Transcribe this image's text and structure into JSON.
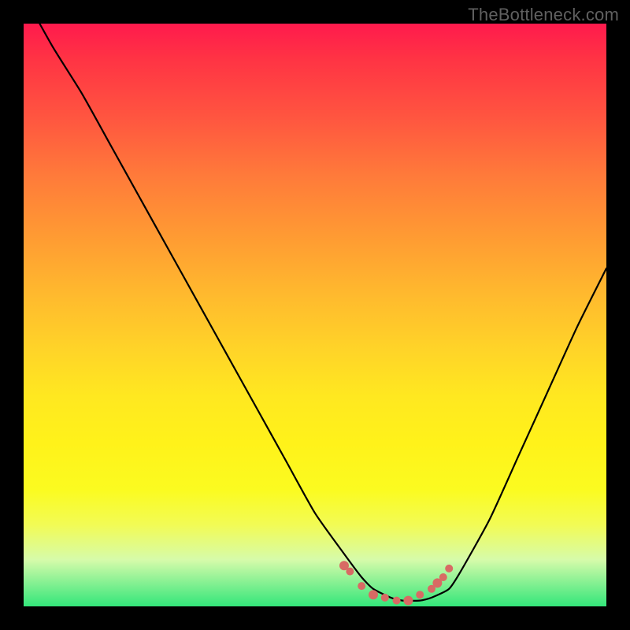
{
  "watermark": "TheBottleneck.com",
  "colors": {
    "background": "#000000",
    "curve": "#000000",
    "marker": "#d86a64",
    "gradient_top": "#ff1a4d",
    "gradient_bottom": "#33e67a"
  },
  "chart_data": {
    "type": "line",
    "title": "",
    "xlabel": "",
    "ylabel": "",
    "xlim": [
      0,
      100
    ],
    "ylim": [
      0,
      100
    ],
    "x": [
      0,
      5,
      10,
      15,
      20,
      25,
      30,
      35,
      40,
      45,
      50,
      55,
      58,
      60,
      63,
      65,
      68,
      70,
      73,
      75,
      80,
      85,
      90,
      95,
      100
    ],
    "values": [
      105,
      96,
      88,
      79,
      70,
      61,
      52,
      43,
      34,
      25,
      16,
      9,
      5,
      3,
      1.5,
      1,
      1,
      1.5,
      3,
      6,
      15,
      26,
      37,
      48,
      58
    ],
    "markers": {
      "x": [
        55,
        56,
        58,
        60,
        62,
        64,
        66,
        68,
        70,
        71,
        72,
        73
      ],
      "y": [
        7,
        6,
        3.5,
        2,
        1.5,
        1,
        1,
        2,
        3,
        4,
        5,
        6.5
      ]
    }
  }
}
